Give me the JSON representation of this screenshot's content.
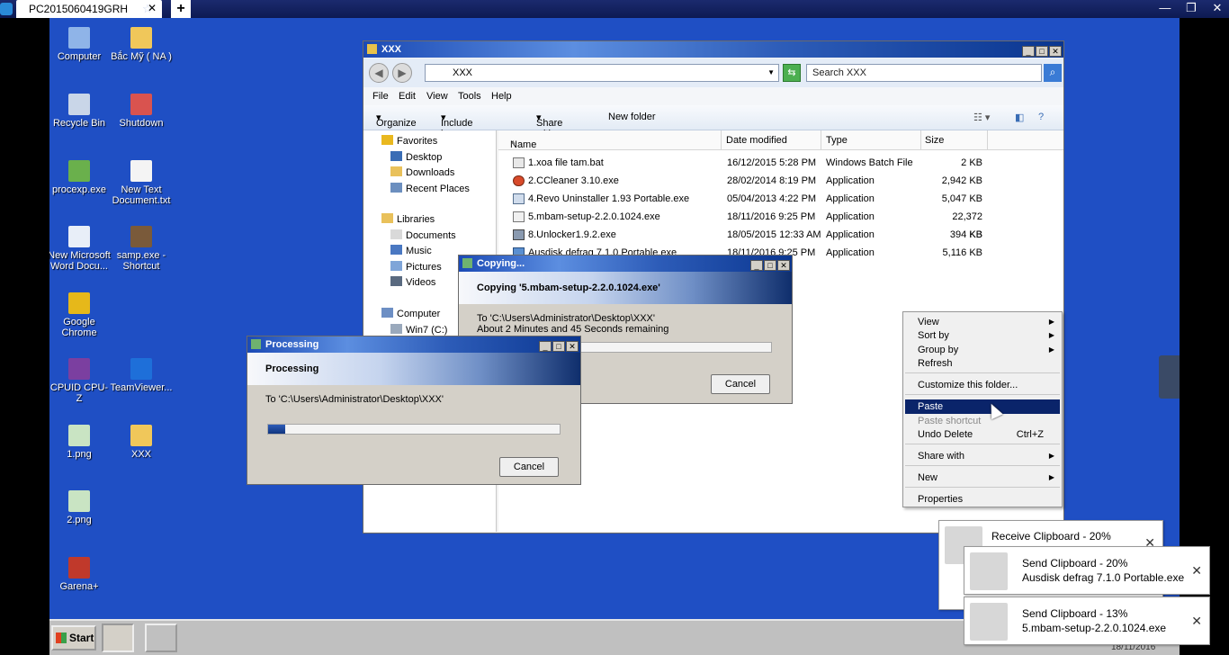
{
  "viewer": {
    "tab_title": "PC2015060419GRH",
    "star": "☆",
    "close": "✕",
    "add": "+",
    "win_controls": [
      "—",
      "❐",
      "✕"
    ]
  },
  "desktop": {
    "icons": [
      {
        "label": "Computer",
        "icon": "computer-icon",
        "color": "#8fb4e8"
      },
      {
        "label": "Bắc Mỹ ( NA )",
        "icon": "folder-icon",
        "color": "#f0c75a"
      },
      {
        "label": "Recycle Bin",
        "icon": "recycle-bin-icon",
        "color": "#c9d6e8"
      },
      {
        "label": "Shutdown",
        "icon": "shutdown-icon",
        "color": "#d9534f"
      },
      {
        "label": "procexp.exe",
        "icon": "procexp-icon",
        "color": "#6ab04c"
      },
      {
        "label": "New Text Document.txt",
        "icon": "text-file-icon",
        "color": "#f4f4f4"
      },
      {
        "label": "New Microsoft Word Docu...",
        "icon": "word-document-icon",
        "color": "#e8eef8"
      },
      {
        "label": "samp.exe - Shortcut",
        "icon": "samp-icon",
        "color": "#7a5a3a"
      },
      {
        "label": "Google Chrome",
        "icon": "chrome-icon",
        "color": "#e6b81a"
      },
      {
        "label": "CPUID CPU-Z",
        "icon": "cpuz-icon",
        "color": "#7b3fa0"
      },
      {
        "label": "TeamViewer...",
        "icon": "teamviewer-icon",
        "color": "#1e6fd9"
      },
      {
        "label": "1.png",
        "icon": "image-file-icon",
        "color": "#c9e4c3"
      },
      {
        "label": "XXX",
        "icon": "folder-icon",
        "color": "#f0c75a"
      },
      {
        "label": "2.png",
        "icon": "image-file-icon",
        "color": "#c9e4c3"
      },
      {
        "label": "Garena+",
        "icon": "garena-icon",
        "color": "#c0392b"
      }
    ]
  },
  "explorer": {
    "title": "XXX",
    "address": "XXX",
    "search_placeholder": "Search XXX",
    "menu": [
      "File",
      "Edit",
      "View",
      "Tools",
      "Help"
    ],
    "commands": [
      "Organize",
      "Include in library",
      "Share with",
      "New folder"
    ],
    "nav": {
      "favorites": "Favorites",
      "fav_items": [
        "Desktop",
        "Downloads",
        "Recent Places"
      ],
      "libraries": "Libraries",
      "lib_items": [
        "Documents",
        "Music",
        "Pictures",
        "Videos"
      ],
      "computer": "Computer",
      "drive": "Win7 (C:)"
    },
    "columns": [
      "Name",
      "Date modified",
      "Type",
      "Size"
    ],
    "files": [
      {
        "name": "1.xoa file tam.bat",
        "date": "16/12/2015 5:28 PM",
        "type": "Windows Batch File",
        "size": "2 KB"
      },
      {
        "name": "2.CCleaner 3.10.exe",
        "date": "28/02/2014 8:19 PM",
        "type": "Application",
        "size": "2,942 KB"
      },
      {
        "name": "4.Revo Uninstaller 1.93 Portable.exe",
        "date": "05/04/2013 4:22 PM",
        "type": "Application",
        "size": "5,047 KB"
      },
      {
        "name": "5.mbam-setup-2.2.0.1024.exe",
        "date": "18/11/2016 9:25 PM",
        "type": "Application",
        "size": "22,372 KB"
      },
      {
        "name": "8.Unlocker1.9.2.exe",
        "date": "18/05/2015 12:33 AM",
        "type": "Application",
        "size": "394 KB"
      },
      {
        "name": "Ausdisk defrag 7.1.0 Portable.exe",
        "date": "18/11/2016 9:25 PM",
        "type": "Application",
        "size": "5,116 KB"
      }
    ]
  },
  "copy_dialog": {
    "title": "Copying...",
    "heading": "Copying '5.mbam-setup-2.2.0.1024.exe'",
    "to": "To 'C:\\Users\\Administrator\\Desktop\\XXX'",
    "remaining": "About 2 Minutes and 45 Seconds remaining",
    "progress": 0.0,
    "cancel": "Cancel"
  },
  "process_dialog": {
    "title": "Processing",
    "heading": "Processing",
    "to": "To 'C:\\Users\\Administrator\\Desktop\\XXX'",
    "progress": 0.06,
    "cancel": "Cancel"
  },
  "context_menu": {
    "items": [
      {
        "label": "View",
        "arrow": "▶"
      },
      {
        "label": "Sort by",
        "arrow": "▶"
      },
      {
        "label": "Group by",
        "arrow": "▶"
      },
      {
        "label": "Refresh"
      },
      {
        "label": "Customize this folder..."
      },
      {
        "label": "Paste",
        "selected": true
      },
      {
        "label": "Paste shortcut",
        "disabled": true
      },
      {
        "label": "Undo Delete",
        "shortcut": "Ctrl+Z"
      },
      {
        "label": "Share with",
        "arrow": "▶"
      },
      {
        "label": "New",
        "arrow": "▶"
      },
      {
        "label": "Properties"
      }
    ]
  },
  "taskbar": {
    "start": "Start",
    "clock": "18/11/2016"
  },
  "notifications": [
    {
      "line1": "Receive Clipboard - 20%",
      "line2": "Ausdisk defrag 7.1.0 Portable.exe"
    },
    {
      "line1": "Send Clipboard - 20%",
      "line2": "Ausdisk defrag 7.1.0 Portable.exe"
    },
    {
      "line1": "Send Clipboard - 13%",
      "line2": "5.mbam-setup-2.2.0.1024.exe"
    }
  ],
  "notif_close": "✕"
}
